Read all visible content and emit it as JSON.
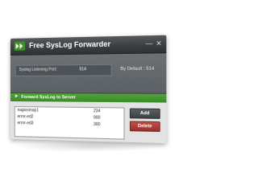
{
  "window": {
    "title": "Free SysLog Forwarder",
    "minimize_glyph": "—",
    "close_glyph": "✕"
  },
  "listening": {
    "label": "Syslog Listening Port:",
    "value": "514",
    "default_text": "By Default : 514"
  },
  "section": {
    "arrow": "►",
    "title": "Forward SysLog to Server"
  },
  "servers": [
    {
      "name": "nagiosmap1",
      "port": "234"
    },
    {
      "name": "error-ed2",
      "port": "900"
    },
    {
      "name": "error-ed3",
      "port": "300"
    }
  ],
  "buttons": {
    "add_label": "Add",
    "delete_label": "Delete"
  },
  "colors": {
    "accent_green": "#3f8f2a",
    "delete_red": "#9a302b",
    "titlebar": "#3a3e41"
  }
}
